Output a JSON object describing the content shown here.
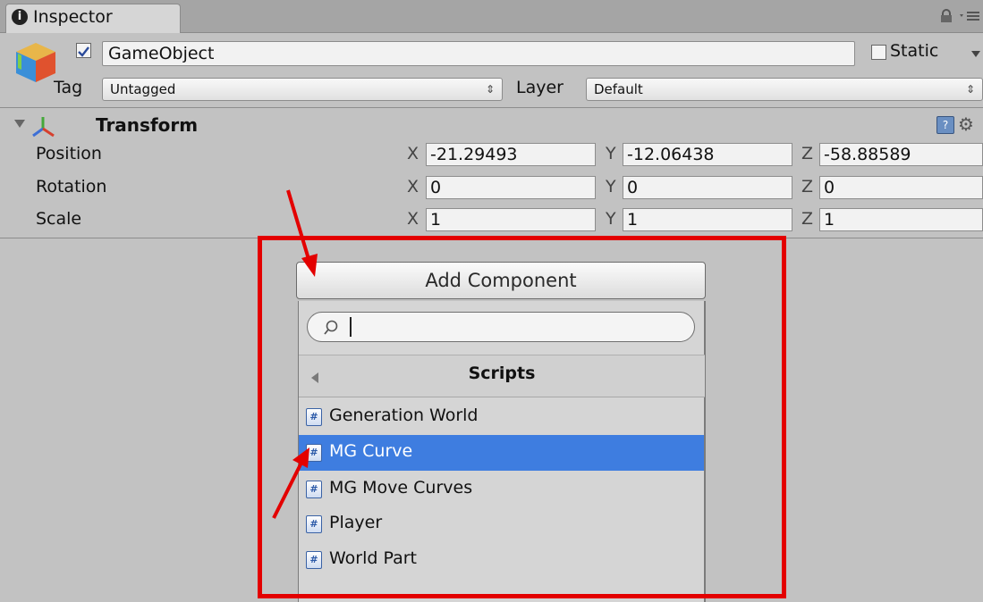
{
  "tab": {
    "title": "Inspector"
  },
  "header": {
    "object_name": "GameObject",
    "active_checked": true,
    "static_label": "Static",
    "tag_label": "Tag",
    "tag_value": "Untagged",
    "layer_label": "Layer",
    "layer_value": "Default"
  },
  "transform": {
    "title": "Transform",
    "axes": {
      "x": "X",
      "y": "Y",
      "z": "Z"
    },
    "rows": [
      {
        "label": "Position",
        "x": "-21.29493",
        "y": "-12.06438",
        "z": "-58.88589"
      },
      {
        "label": "Rotation",
        "x": "0",
        "y": "0",
        "z": "0"
      },
      {
        "label": "Scale",
        "x": "1",
        "y": "1",
        "z": "1"
      }
    ]
  },
  "add_component": {
    "button_label": "Add Component",
    "search_value": "",
    "category_title": "Scripts",
    "selected_index": 1,
    "items": [
      {
        "label": "Generation World"
      },
      {
        "label": "MG Curve"
      },
      {
        "label": "MG Move Curves"
      },
      {
        "label": "Player"
      },
      {
        "label": "World Part"
      }
    ]
  },
  "colors": {
    "highlight": "#e30000",
    "selection": "#3e7de0",
    "background": "#c2c2c2"
  }
}
